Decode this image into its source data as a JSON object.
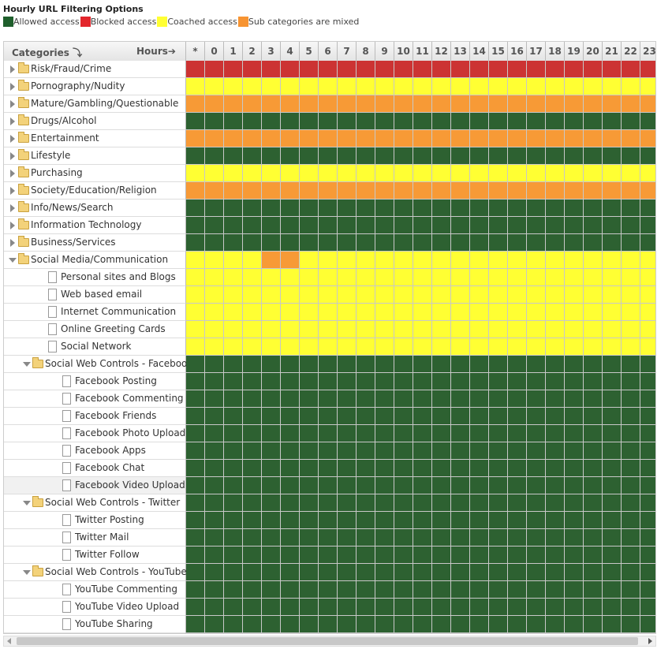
{
  "title": "Hourly URL Filtering Options",
  "legend": [
    {
      "label": "Allowed access",
      "color": "#1f5f2c"
    },
    {
      "label": "Blocked access",
      "color": "#e3262c"
    },
    {
      "label": "Coached access",
      "color": "#ffff33"
    },
    {
      "label": "Sub categories are mixed",
      "color": "#f79432"
    }
  ],
  "colors": {
    "allowed": "#2d6131",
    "blocked": "#cc3333",
    "coached": "#ffff33",
    "mixed": "#f79a36"
  },
  "header": {
    "categories_label": "Categories",
    "hours_label": "Hours",
    "hours": [
      "*",
      "0",
      "1",
      "2",
      "3",
      "4",
      "5",
      "6",
      "7",
      "8",
      "9",
      "10",
      "11",
      "12",
      "13",
      "14",
      "15",
      "16",
      "17",
      "18",
      "19",
      "20",
      "21",
      "22",
      "23"
    ]
  },
  "rows": [
    {
      "label": "Risk/Fraud/Crime",
      "type": "folder",
      "level": 0,
      "expanded": false,
      "status": "blocked"
    },
    {
      "label": "Pornography/Nudity",
      "type": "folder",
      "level": 0,
      "expanded": false,
      "status": "coached"
    },
    {
      "label": "Mature/Gambling/Questionable",
      "type": "folder",
      "level": 0,
      "expanded": false,
      "status": "mixed"
    },
    {
      "label": "Drugs/Alcohol",
      "type": "folder",
      "level": 0,
      "expanded": false,
      "status": "allowed"
    },
    {
      "label": "Entertainment",
      "type": "folder",
      "level": 0,
      "expanded": false,
      "status": "mixed"
    },
    {
      "label": "Lifestyle",
      "type": "folder",
      "level": 0,
      "expanded": false,
      "status": "allowed"
    },
    {
      "label": "Purchasing",
      "type": "folder",
      "level": 0,
      "expanded": false,
      "status": "coached"
    },
    {
      "label": "Society/Education/Religion",
      "type": "folder",
      "level": 0,
      "expanded": false,
      "status": "mixed"
    },
    {
      "label": "Info/News/Search",
      "type": "folder",
      "level": 0,
      "expanded": false,
      "status": "allowed"
    },
    {
      "label": "Information Technology",
      "type": "folder",
      "level": 0,
      "expanded": false,
      "status": "allowed"
    },
    {
      "label": "Business/Services",
      "type": "folder",
      "level": 0,
      "expanded": false,
      "status": "allowed"
    },
    {
      "label": "Social Media/Communication",
      "type": "folder",
      "level": 0,
      "expanded": true,
      "status": "coached",
      "overrides": {
        "3": "mixed",
        "4": "mixed"
      }
    },
    {
      "label": "Personal sites and Blogs",
      "type": "doc",
      "level": 1,
      "status": "coached"
    },
    {
      "label": "Web based email",
      "type": "doc",
      "level": 1,
      "status": "coached"
    },
    {
      "label": "Internet Communication",
      "type": "doc",
      "level": 1,
      "status": "coached"
    },
    {
      "label": "Online Greeting Cards",
      "type": "doc",
      "level": 1,
      "status": "coached"
    },
    {
      "label": "Social Network",
      "type": "doc",
      "level": 1,
      "status": "coached"
    },
    {
      "label": "Social Web Controls - Facebook",
      "type": "folder",
      "level": 1,
      "expanded": true,
      "status": "allowed"
    },
    {
      "label": "Facebook Posting",
      "type": "doc",
      "level": 2,
      "status": "allowed"
    },
    {
      "label": "Facebook Commenting",
      "type": "doc",
      "level": 2,
      "status": "allowed"
    },
    {
      "label": "Facebook Friends",
      "type": "doc",
      "level": 2,
      "status": "allowed"
    },
    {
      "label": "Facebook Photo Upload",
      "type": "doc",
      "level": 2,
      "status": "allowed"
    },
    {
      "label": "Facebook Apps",
      "type": "doc",
      "level": 2,
      "status": "allowed"
    },
    {
      "label": "Facebook Chat",
      "type": "doc",
      "level": 2,
      "status": "allowed"
    },
    {
      "label": "Facebook Video Upload",
      "type": "doc",
      "level": 2,
      "status": "allowed",
      "selected": true
    },
    {
      "label": "Social Web Controls - Twitter",
      "type": "folder",
      "level": 1,
      "expanded": true,
      "status": "allowed"
    },
    {
      "label": "Twitter Posting",
      "type": "doc",
      "level": 2,
      "status": "allowed"
    },
    {
      "label": "Twitter Mail",
      "type": "doc",
      "level": 2,
      "status": "allowed"
    },
    {
      "label": "Twitter Follow",
      "type": "doc",
      "level": 2,
      "status": "allowed"
    },
    {
      "label": "Social Web Controls - YouTube",
      "type": "folder",
      "level": 1,
      "expanded": true,
      "status": "allowed"
    },
    {
      "label": "YouTube Commenting",
      "type": "doc",
      "level": 2,
      "status": "allowed"
    },
    {
      "label": "YouTube Video Upload",
      "type": "doc",
      "level": 2,
      "status": "allowed"
    },
    {
      "label": "YouTube Sharing",
      "type": "doc",
      "level": 2,
      "status": "allowed"
    }
  ]
}
